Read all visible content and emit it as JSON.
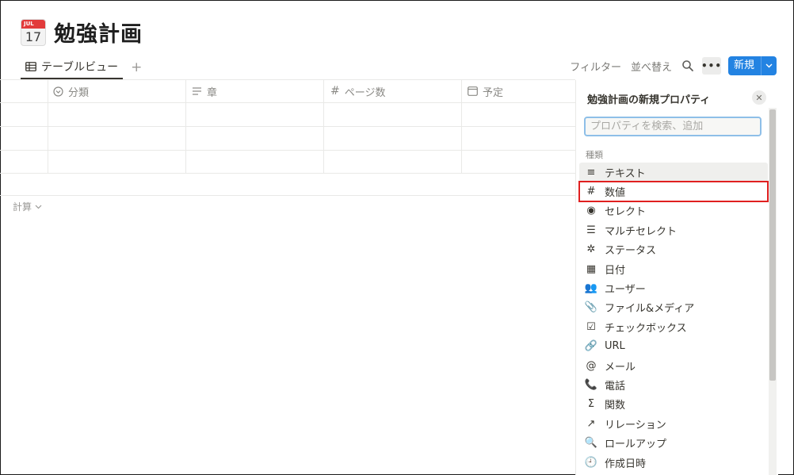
{
  "page": {
    "icon": {
      "name": "calendar-icon",
      "month": "JUL",
      "day": "17"
    },
    "title": "勉強計画"
  },
  "views": {
    "active_tab": "テーブルビュー",
    "add_label": "+"
  },
  "toolbar": {
    "filter": "フィルター",
    "sort": "並べ替え",
    "more": "•••",
    "new": "新規"
  },
  "table": {
    "columns": [
      {
        "icon": "select-icon",
        "label": "分類"
      },
      {
        "icon": "text-icon",
        "label": "章"
      },
      {
        "icon": "number-icon",
        "label": "ページ数"
      },
      {
        "icon": "date-icon",
        "label": "予定"
      }
    ],
    "calc_label": "計算"
  },
  "panel": {
    "title": "勉強計画の新規プロパティ",
    "search_placeholder": "プロパティを検索、追加",
    "section_label": "種類",
    "types": [
      {
        "icon": "text-icon",
        "glyph": "≡",
        "label": "テキスト"
      },
      {
        "icon": "number-icon",
        "glyph": "#",
        "label": "数値"
      },
      {
        "icon": "select-icon",
        "glyph": "◉",
        "label": "セレクト"
      },
      {
        "icon": "multi-select-icon",
        "glyph": "☰",
        "label": "マルチセレクト"
      },
      {
        "icon": "status-icon",
        "glyph": "✲",
        "label": "ステータス"
      },
      {
        "icon": "date-icon",
        "glyph": "▦",
        "label": "日付"
      },
      {
        "icon": "person-icon",
        "glyph": "👥",
        "label": "ユーザー"
      },
      {
        "icon": "attachment-icon",
        "glyph": "📎",
        "label": "ファイル&メディア"
      },
      {
        "icon": "checkbox-icon",
        "glyph": "☑",
        "label": "チェックボックス"
      },
      {
        "icon": "link-icon",
        "glyph": "🔗",
        "label": "URL"
      },
      {
        "icon": "at-icon",
        "glyph": "@",
        "label": "メール"
      },
      {
        "icon": "phone-icon",
        "glyph": "📞",
        "label": "電話"
      },
      {
        "icon": "sigma-icon",
        "glyph": "Σ",
        "label": "関数"
      },
      {
        "icon": "arrow-up-right-icon",
        "glyph": "↗",
        "label": "リレーション"
      },
      {
        "icon": "search-icon",
        "glyph": "🔍",
        "label": "ロールアップ"
      },
      {
        "icon": "clock-icon",
        "glyph": "🕘",
        "label": "作成日時"
      }
    ]
  },
  "colors": {
    "accent": "#2383e2",
    "highlight": "#e02020"
  }
}
